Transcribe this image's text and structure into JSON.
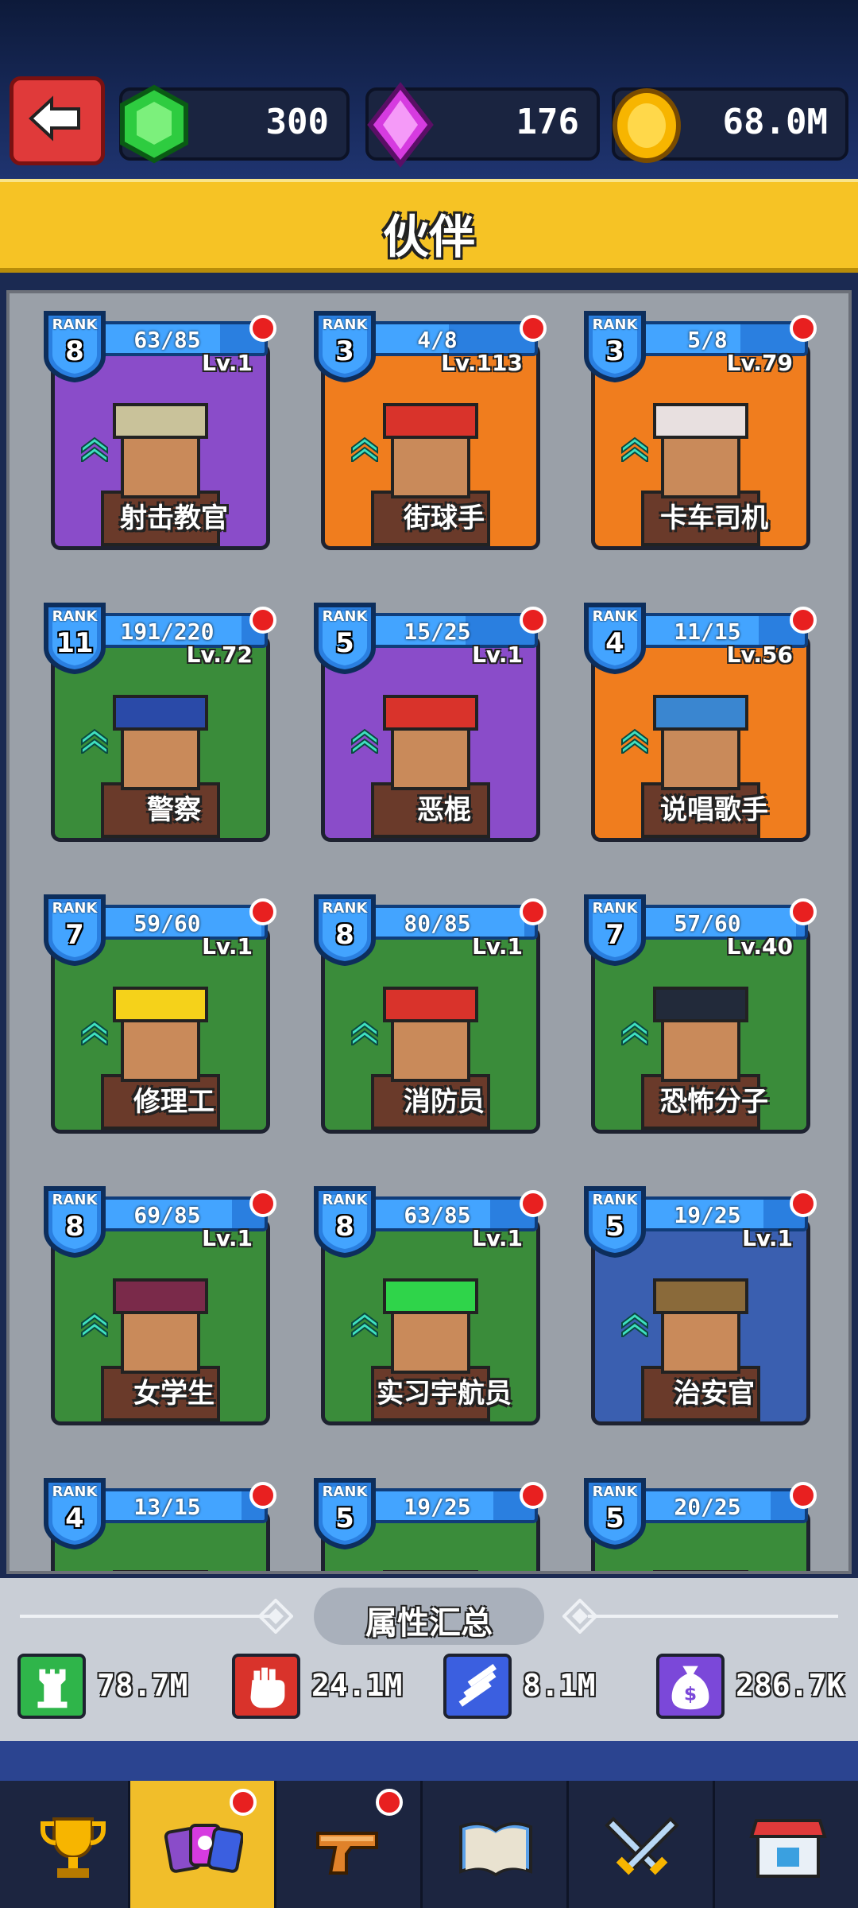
{
  "header": {
    "gems_green": "300",
    "gems_purple": "176",
    "coins": "68.0M"
  },
  "title": "伙伴",
  "cards": [
    {
      "rank_label": "RANK",
      "rank": "8",
      "progress": "63/85",
      "level": "Lv.1",
      "name": "射击教官",
      "bg": "#8a4cc9"
    },
    {
      "rank_label": "RANK",
      "rank": "3",
      "progress": "4/8",
      "level": "Lv.113",
      "name": "街球手",
      "bg": "#f07d1e"
    },
    {
      "rank_label": "RANK",
      "rank": "3",
      "progress": "5/8",
      "level": "Lv.79",
      "name": "卡车司机",
      "bg": "#f07d1e"
    },
    {
      "rank_label": "RANK",
      "rank": "11",
      "progress": "191/220",
      "level": "Lv.72",
      "name": "警察",
      "bg": "#3a8c3a"
    },
    {
      "rank_label": "RANK",
      "rank": "5",
      "progress": "15/25",
      "level": "Lv.1",
      "name": "恶棍",
      "bg": "#8a4cc9"
    },
    {
      "rank_label": "RANK",
      "rank": "4",
      "progress": "11/15",
      "level": "Lv.56",
      "name": "说唱歌手",
      "bg": "#f07d1e"
    },
    {
      "rank_label": "RANK",
      "rank": "7",
      "progress": "59/60",
      "level": "Lv.1",
      "name": "修理工",
      "bg": "#3a8c3a"
    },
    {
      "rank_label": "RANK",
      "rank": "8",
      "progress": "80/85",
      "level": "Lv.1",
      "name": "消防员",
      "bg": "#3a8c3a"
    },
    {
      "rank_label": "RANK",
      "rank": "7",
      "progress": "57/60",
      "level": "Lv.40",
      "name": "恐怖分子",
      "bg": "#3a8c3a"
    },
    {
      "rank_label": "RANK",
      "rank": "8",
      "progress": "69/85",
      "level": "Lv.1",
      "name": "女学生",
      "bg": "#3a8c3a"
    },
    {
      "rank_label": "RANK",
      "rank": "8",
      "progress": "63/85",
      "level": "Lv.1",
      "name": "实习宇航员",
      "bg": "#3a8c3a"
    },
    {
      "rank_label": "RANK",
      "rank": "5",
      "progress": "19/25",
      "level": "Lv.1",
      "name": "治安官",
      "bg": "#3a5fb0"
    },
    {
      "rank_label": "RANK",
      "rank": "4",
      "progress": "13/15",
      "level": "",
      "name": "",
      "bg": "#3a8c3a"
    },
    {
      "rank_label": "RANK",
      "rank": "5",
      "progress": "19/25",
      "level": "",
      "name": "",
      "bg": "#3a8c3a"
    },
    {
      "rank_label": "RANK",
      "rank": "5",
      "progress": "20/25",
      "level": "",
      "name": "",
      "bg": "#3a8c3a"
    }
  ],
  "attributes": {
    "title": "属性汇总",
    "stats": [
      {
        "icon": "tower-icon",
        "value": "78.7M",
        "color": "#2fb54a"
      },
      {
        "icon": "fist-icon",
        "value": "24.1M",
        "color": "#d9332b"
      },
      {
        "icon": "ammo-icon",
        "value": "8.1M",
        "color": "#3b5fe0"
      },
      {
        "icon": "money-bag-icon",
        "value": "286.7K",
        "color": "#7b48d9"
      }
    ]
  },
  "nav": [
    {
      "icon": "trophy-icon",
      "active": false,
      "dot": false
    },
    {
      "icon": "cards-icon",
      "active": true,
      "dot": true
    },
    {
      "icon": "pistol-icon",
      "active": false,
      "dot": true
    },
    {
      "icon": "book-icon",
      "active": false,
      "dot": false
    },
    {
      "icon": "crossed-swords-icon",
      "active": false,
      "dot": false
    },
    {
      "icon": "shop-icon",
      "active": false,
      "dot": false
    }
  ]
}
